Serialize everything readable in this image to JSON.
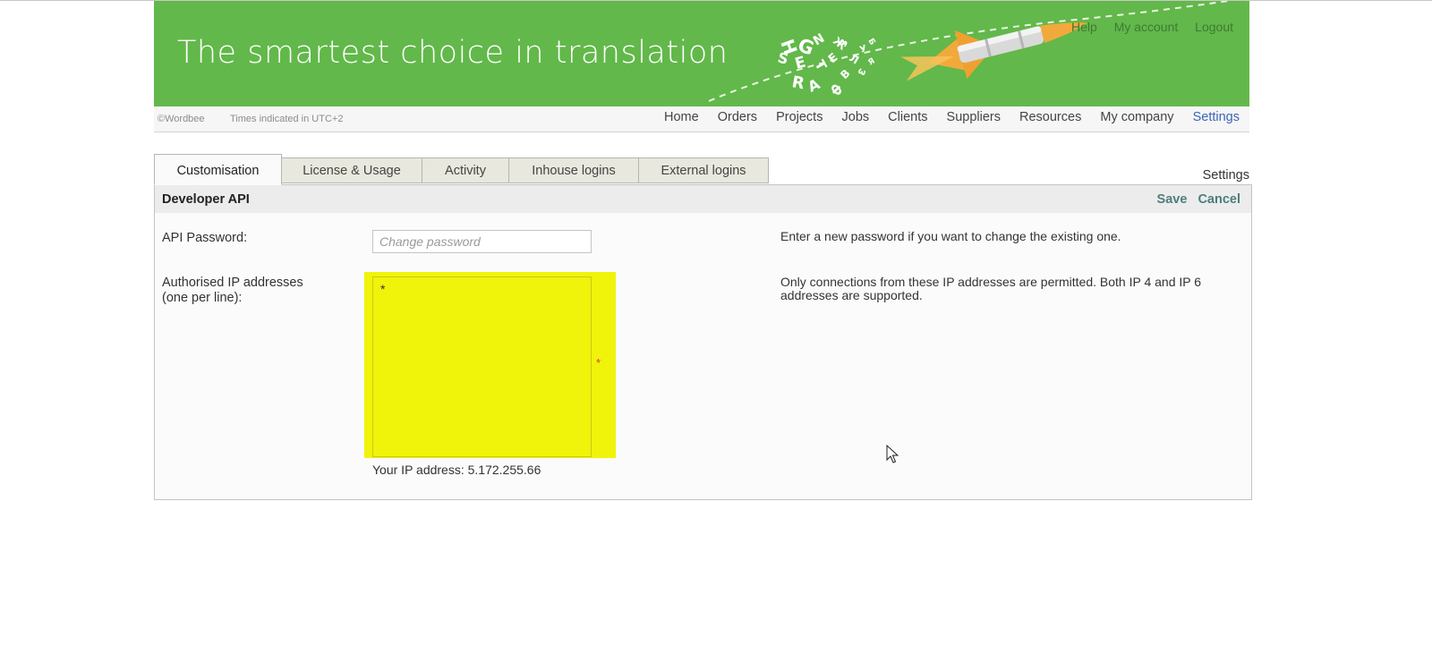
{
  "header": {
    "tagline": "The smartest choice in translation",
    "links": [
      "Help",
      "My account",
      "Logout"
    ]
  },
  "menubar": {
    "copyright": "©Wordbee",
    "timezone": "Times indicated in UTC+2",
    "nav": [
      "Home",
      "Orders",
      "Projects",
      "Jobs",
      "Clients",
      "Suppliers",
      "Resources",
      "My company",
      "Settings"
    ],
    "active": "Settings"
  },
  "tabs": {
    "items": [
      "Customisation",
      "License & Usage",
      "Activity",
      "Inhouse logins",
      "External logins"
    ],
    "active": "Customisation",
    "section_label": "Settings"
  },
  "panel": {
    "title": "Developer API",
    "save_label": "Save",
    "cancel_label": "Cancel",
    "api_password": {
      "label": "API Password:",
      "value": "",
      "placeholder": "Change password",
      "hint": "Enter a new password if you want to change the existing one."
    },
    "ip_addresses": {
      "label_line1": "Authorised IP addresses",
      "label_line2": "(one per line):",
      "value": "*",
      "required_marker": "*",
      "your_ip": "Your IP address: 5.172.255.66",
      "hint": "Only connections from these IP addresses are permitted. Both IP 4 and IP 6 addresses are supported."
    }
  },
  "colors": {
    "banner_green": "#62b84a",
    "highlight_yellow": "#f0f30a",
    "active_link_blue": "#3e64b4",
    "action_teal": "#4d7f7c",
    "required_red": "#e03a2a"
  },
  "icons": {
    "banner_graphic": "rocket-icon",
    "pointer": "mouse-pointer-icon"
  }
}
